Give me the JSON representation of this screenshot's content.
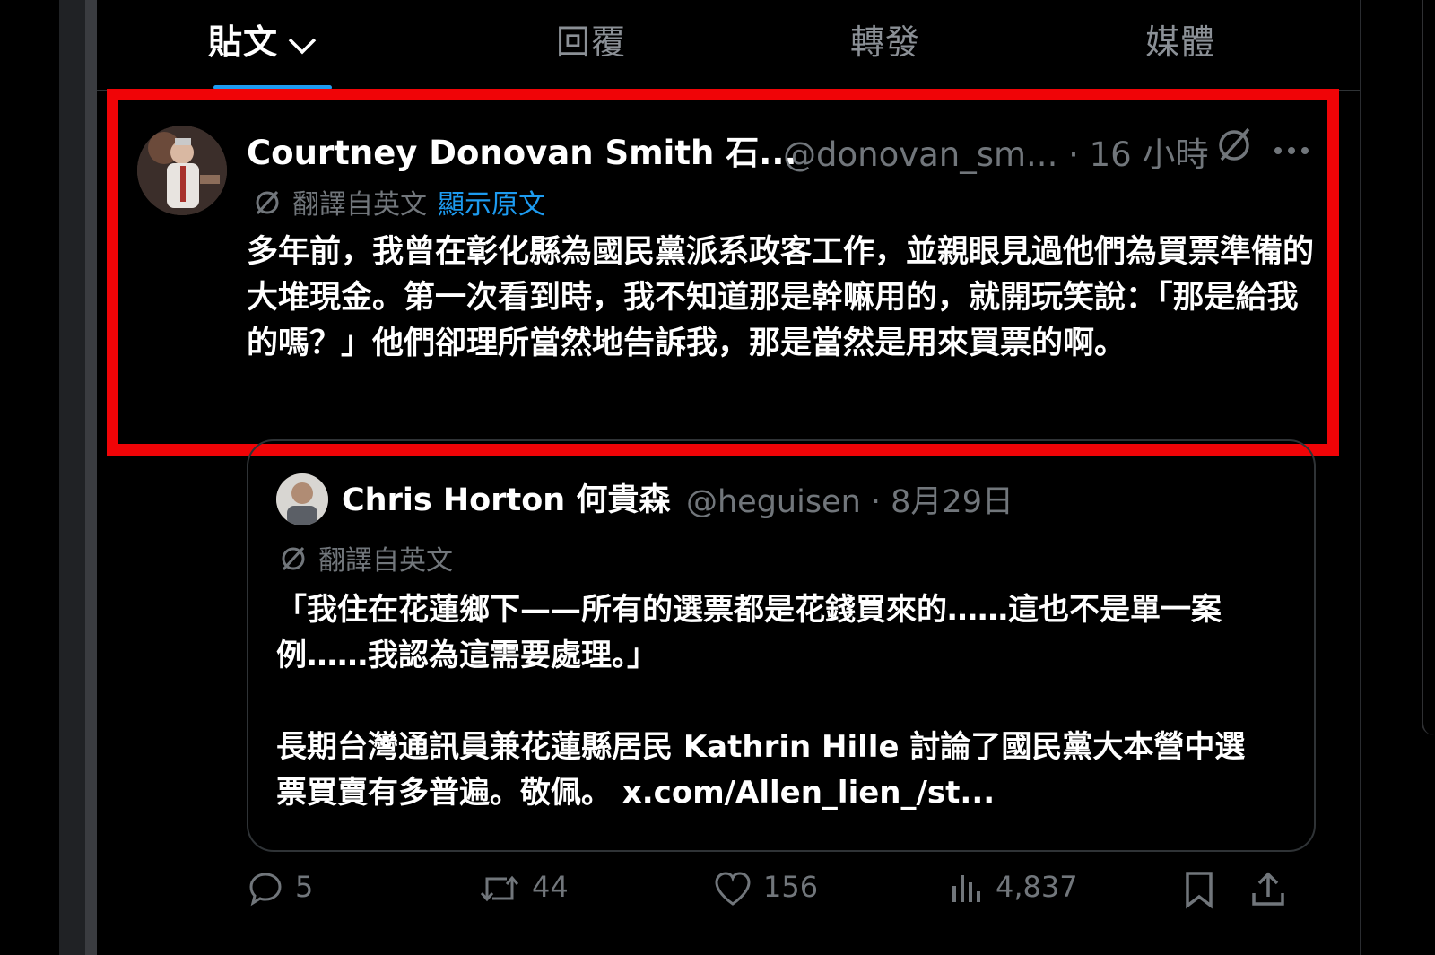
{
  "tabs": [
    {
      "label": "貼文"
    },
    {
      "label": "回覆"
    },
    {
      "label": "轉發"
    },
    {
      "label": "媒體"
    }
  ],
  "tweet": {
    "author_name": "Courtney Donovan Smith 石...",
    "meta": "@donovan_sm... · 16 小時",
    "translated_label": "翻譯自英文",
    "show_original_label": "顯示原文",
    "text": "多年前，我曾在彰化縣為國民黨派系政客工作，並親眼見過他們為買票準備的大堆現金。第一次看到時，我不知道那是幹嘛用的，就開玩笑說：「那是給我的嗎？」他們卻理所當然地告訴我，那是當然是用來買票的啊。"
  },
  "quote": {
    "author_name": "Chris Horton 何貴森",
    "meta": "@heguisen · 8月29日",
    "translated_label": "翻譯自英文",
    "paragraph1": "「我住在花蓮鄉下——所有的選票都是花錢買來的……這也不是單一案例……我認為這需要處理。」",
    "paragraph2": "長期台灣通訊員兼花蓮縣居民 Kathrin Hille 討論了國民黨大本營中選票買賣有多普遍。敬佩。 x.com/Allen_lien_/st..."
  },
  "actions": {
    "replies": "5",
    "reposts": "44",
    "likes": "156",
    "views": "4,837"
  },
  "colors": {
    "background": "#000000",
    "accent": "#1d9bf0",
    "highlight_border": "#f00407",
    "muted_text": "#71767b"
  }
}
